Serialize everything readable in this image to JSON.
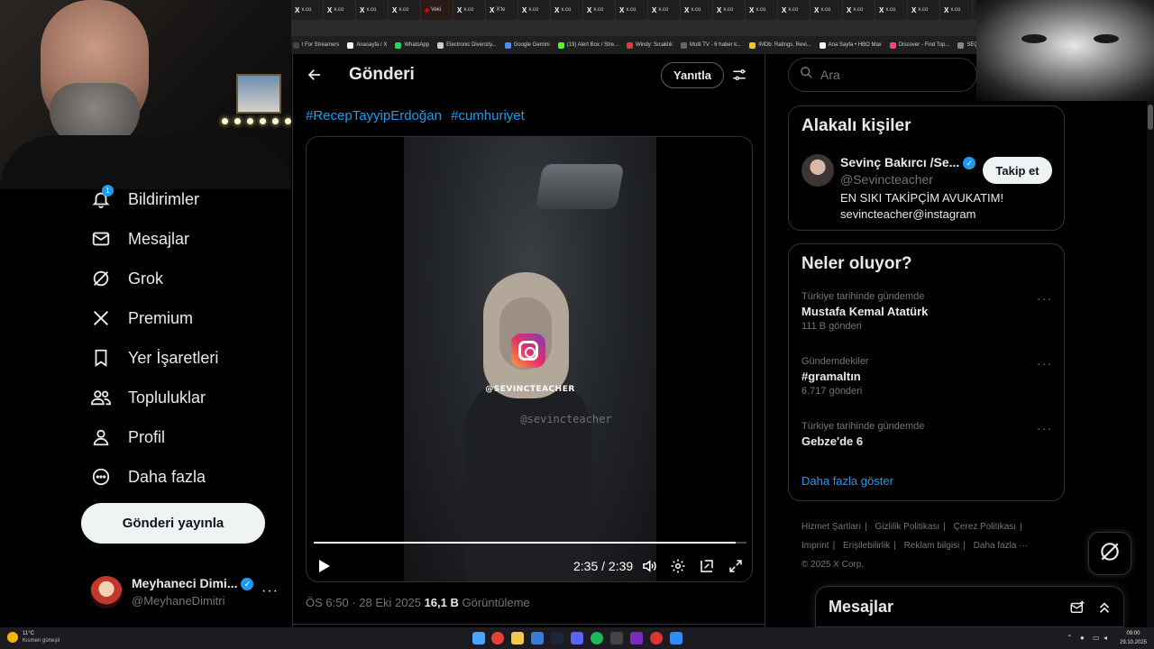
{
  "browser": {
    "tabs": [
      {
        "label": "x.co",
        "icon": "x-icon"
      },
      {
        "label": "x.co",
        "icon": "x-icon"
      },
      {
        "label": "x.co",
        "icon": "x-icon"
      },
      {
        "label": "x.co",
        "icon": "x-icon"
      },
      {
        "label": "Veki",
        "icon": "red-favicon"
      },
      {
        "label": "x.co",
        "icon": "x-icon"
      },
      {
        "label": "X'te",
        "icon": "x-icon"
      },
      {
        "label": "x.co",
        "icon": "x-icon"
      },
      {
        "label": "x.co",
        "icon": "x-icon"
      },
      {
        "label": "x.co",
        "icon": "x-icon"
      },
      {
        "label": "x.co",
        "icon": "x-icon"
      },
      {
        "label": "x.co",
        "icon": "x-icon"
      },
      {
        "label": "x.co",
        "icon": "x-icon"
      },
      {
        "label": "x.co",
        "icon": "x-icon"
      },
      {
        "label": "x.co",
        "icon": "x-icon"
      },
      {
        "label": "x.co",
        "icon": "x-icon"
      },
      {
        "label": "x.co",
        "icon": "x-icon"
      },
      {
        "label": "x.co",
        "icon": "x-icon"
      },
      {
        "label": "x.co",
        "icon": "x-icon"
      },
      {
        "label": "x.co",
        "icon": "x-icon"
      },
      {
        "label": "x.co",
        "icon": "x-icon"
      }
    ],
    "bookmarks": [
      {
        "label": "l For Streamers",
        "color": "#444444"
      },
      {
        "label": "Anasayfa / X",
        "color": "#ffffff"
      },
      {
        "label": "WhatsApp",
        "color": "#25d366"
      },
      {
        "label": "Electronic Diversity...",
        "color": "#cccccc"
      },
      {
        "label": "Google Gemini",
        "color": "#4f8ef7"
      },
      {
        "label": "(19) Alert Box / Stre...",
        "color": "#53fc18"
      },
      {
        "label": "Windy: Sıcaklık",
        "color": "#e53935"
      },
      {
        "label": "Multi TV - 6 haber k...",
        "color": "#666666"
      },
      {
        "label": "IMDb: Ratings, Revi...",
        "color": "#f5c518"
      },
      {
        "label": "Ana Sayfa • HBO Max",
        "color": "#ffffff"
      },
      {
        "label": "Discover - Find Top...",
        "color": "#ff4081"
      },
      {
        "label": "SEÇİM S",
        "color": "#888888"
      }
    ]
  },
  "nav": {
    "notifications": {
      "label": "Bildirimler",
      "badge": "1"
    },
    "messages": "Mesajlar",
    "grok": "Grok",
    "premium": "Premium",
    "bookmarks": "Yer İşaretleri",
    "communities": "Topluluklar",
    "profile": "Profil",
    "more": "Daha fazla",
    "post_button": "Gönderi yayınla",
    "account": {
      "name": "Meyhaneci Dimi...",
      "handle": "@MeyhaneDimitri"
    }
  },
  "main": {
    "title": "Gönderi",
    "reply_button": "Yanıtla",
    "hashtags": [
      "#RecepTayyipErdoğan",
      "#cumhuriyet"
    ],
    "video": {
      "overlay_handle": "@SEVINCTEACHER",
      "watermark": "@sevincteacher",
      "timecode": "2:35 / 2:39",
      "progress": 0.975
    },
    "meta": {
      "time": "ÖS 6:50",
      "sep": " · ",
      "date": "28 Eki 2025",
      "views_count": "16,1 B",
      "views_label": "Görüntüleme"
    }
  },
  "search": {
    "placeholder": "Ara"
  },
  "related": {
    "title": "Alakalı kişiler",
    "person": {
      "name": "Sevinç Bakırcı /Se...",
      "handle": "@Sevincteacher",
      "bio_line1": "EN SIKI TAKİPÇİM AVUKATIM!",
      "bio_line2": "sevincteacher@instagram",
      "follow_label": "Takip et"
    }
  },
  "trends": {
    "title": "Neler oluyor?",
    "items": [
      {
        "context": "Türkiye tarihinde gündemde",
        "title": "Mustafa Kemal Atatürk",
        "count": "111 B gönderi"
      },
      {
        "context": "Gündemdekiler",
        "title": "#gramaltın",
        "count": "6.717 gönderi"
      },
      {
        "context": "Türkiye tarihinde gündemde",
        "title": "Gebze'de 6",
        "count": ""
      }
    ],
    "show_more": "Daha fazla göster"
  },
  "footer": {
    "links": [
      "Hizmet Şartları",
      "Gizlilik Politikası",
      "Çerez Politikası",
      "Imprint",
      "Erişilebilirlik",
      "Reklam bilgisi",
      "Daha fazla ···"
    ],
    "copyright": "© 2025 X Corp."
  },
  "messages_drawer": {
    "title": "Mesajlar"
  },
  "taskbar": {
    "weather_temp": "11°C",
    "weather_desc": "Kısmen güneşli",
    "time": "09:00",
    "date": "29.10.2025"
  }
}
